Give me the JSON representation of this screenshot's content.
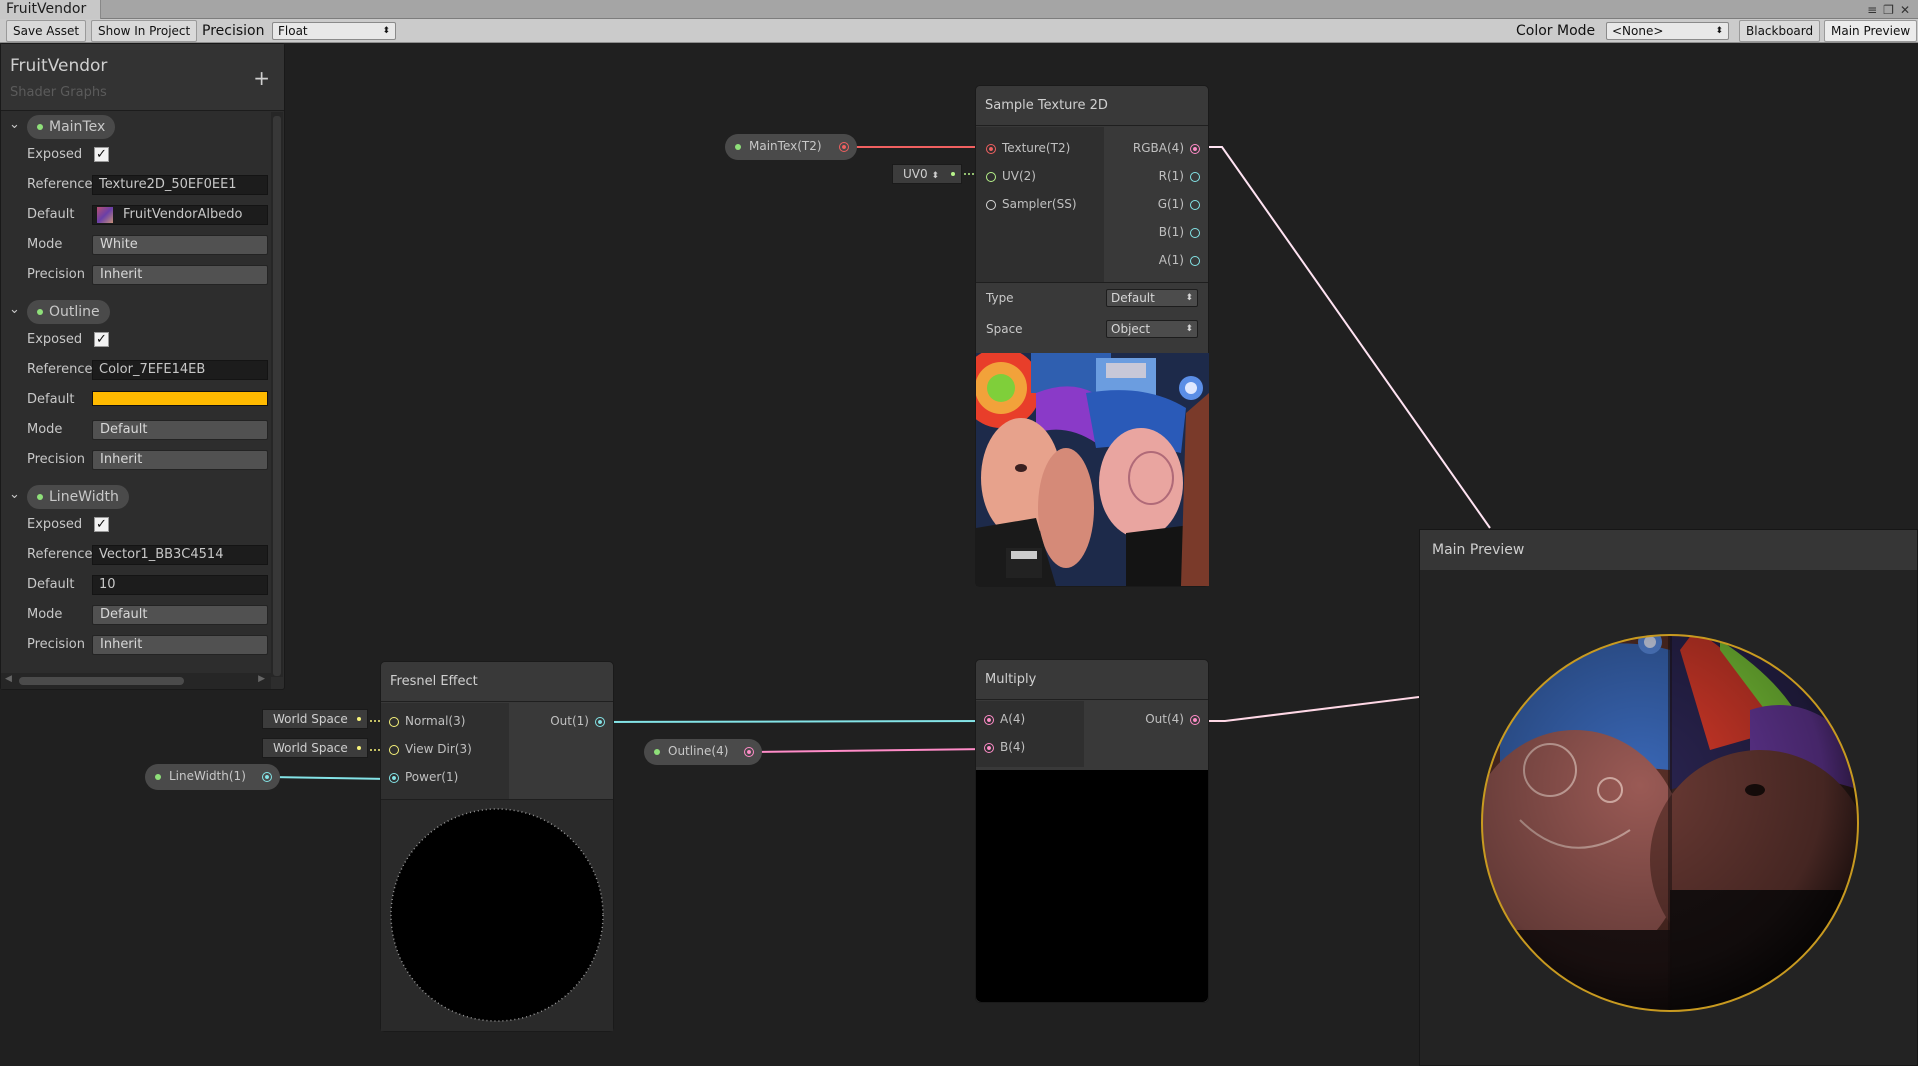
{
  "window": {
    "tab_title": "FruitVendor"
  },
  "toolbar": {
    "save_asset": "Save Asset",
    "show_in_project": "Show In Project",
    "precision_label": "Precision",
    "precision_value": "Float",
    "color_mode_label": "Color Mode",
    "color_mode_value": "<None>",
    "blackboard": "Blackboard",
    "main_preview": "Main Preview"
  },
  "blackboard": {
    "title": "FruitVendor",
    "subtitle": "Shader Graphs",
    "properties": [
      {
        "name": "MainTex",
        "labels": {
          "exposed": "Exposed",
          "reference": "Reference",
          "default": "Default",
          "mode": "Mode",
          "precision": "Precision"
        },
        "reference": "Texture2D_50EF0EE1",
        "default": "FruitVendorAlbedo",
        "mode": "White",
        "precision": "Inherit"
      },
      {
        "name": "Outline",
        "labels": {
          "exposed": "Exposed",
          "reference": "Reference",
          "default": "Default",
          "mode": "Mode",
          "precision": "Precision"
        },
        "reference": "Color_7EFE14EB",
        "default_color": "#ffba00",
        "mode": "Default",
        "precision": "Inherit"
      },
      {
        "name": "LineWidth",
        "labels": {
          "exposed": "Exposed",
          "reference": "Reference",
          "default": "Default",
          "mode": "Mode",
          "precision": "Precision"
        },
        "reference": "Vector1_BB3C4514",
        "default": "10",
        "mode": "Default",
        "precision": "Inherit"
      }
    ]
  },
  "nodes": {
    "sample_texture": {
      "title": "Sample Texture 2D",
      "inputs": [
        "Texture(T2)",
        "UV(2)",
        "Sampler(SS)"
      ],
      "outputs": [
        "RGBA(4)",
        "R(1)",
        "G(1)",
        "B(1)",
        "A(1)"
      ],
      "type_label": "Type",
      "type_value": "Default",
      "space_label": "Space",
      "space_value": "Object",
      "uv_value": "UV0"
    },
    "maintex_prop": {
      "label": "MainTex(T2)"
    },
    "fresnel": {
      "title": "Fresnel Effect",
      "inputs": [
        "Normal(3)",
        "View Dir(3)",
        "Power(1)"
      ],
      "output": "Out(1)",
      "normal_default": "World Space",
      "viewdir_default": "World Space"
    },
    "linewidth_prop": {
      "label": "LineWidth(1)"
    },
    "outline_prop": {
      "label": "Outline(4)"
    },
    "multiply": {
      "title": "Multiply",
      "inputs": [
        "A(4)",
        "B(4)"
      ],
      "output": "Out(4)"
    }
  },
  "main_preview": {
    "title": "Main Preview"
  },
  "colors": {
    "texture_port": "#f06060",
    "vector4_port": "#ff8cc8",
    "float_port": "#84e4e7",
    "vector3_port": "#f7f37a",
    "vector2_port": "#b7f38a",
    "outline_color": "#ffba00"
  }
}
